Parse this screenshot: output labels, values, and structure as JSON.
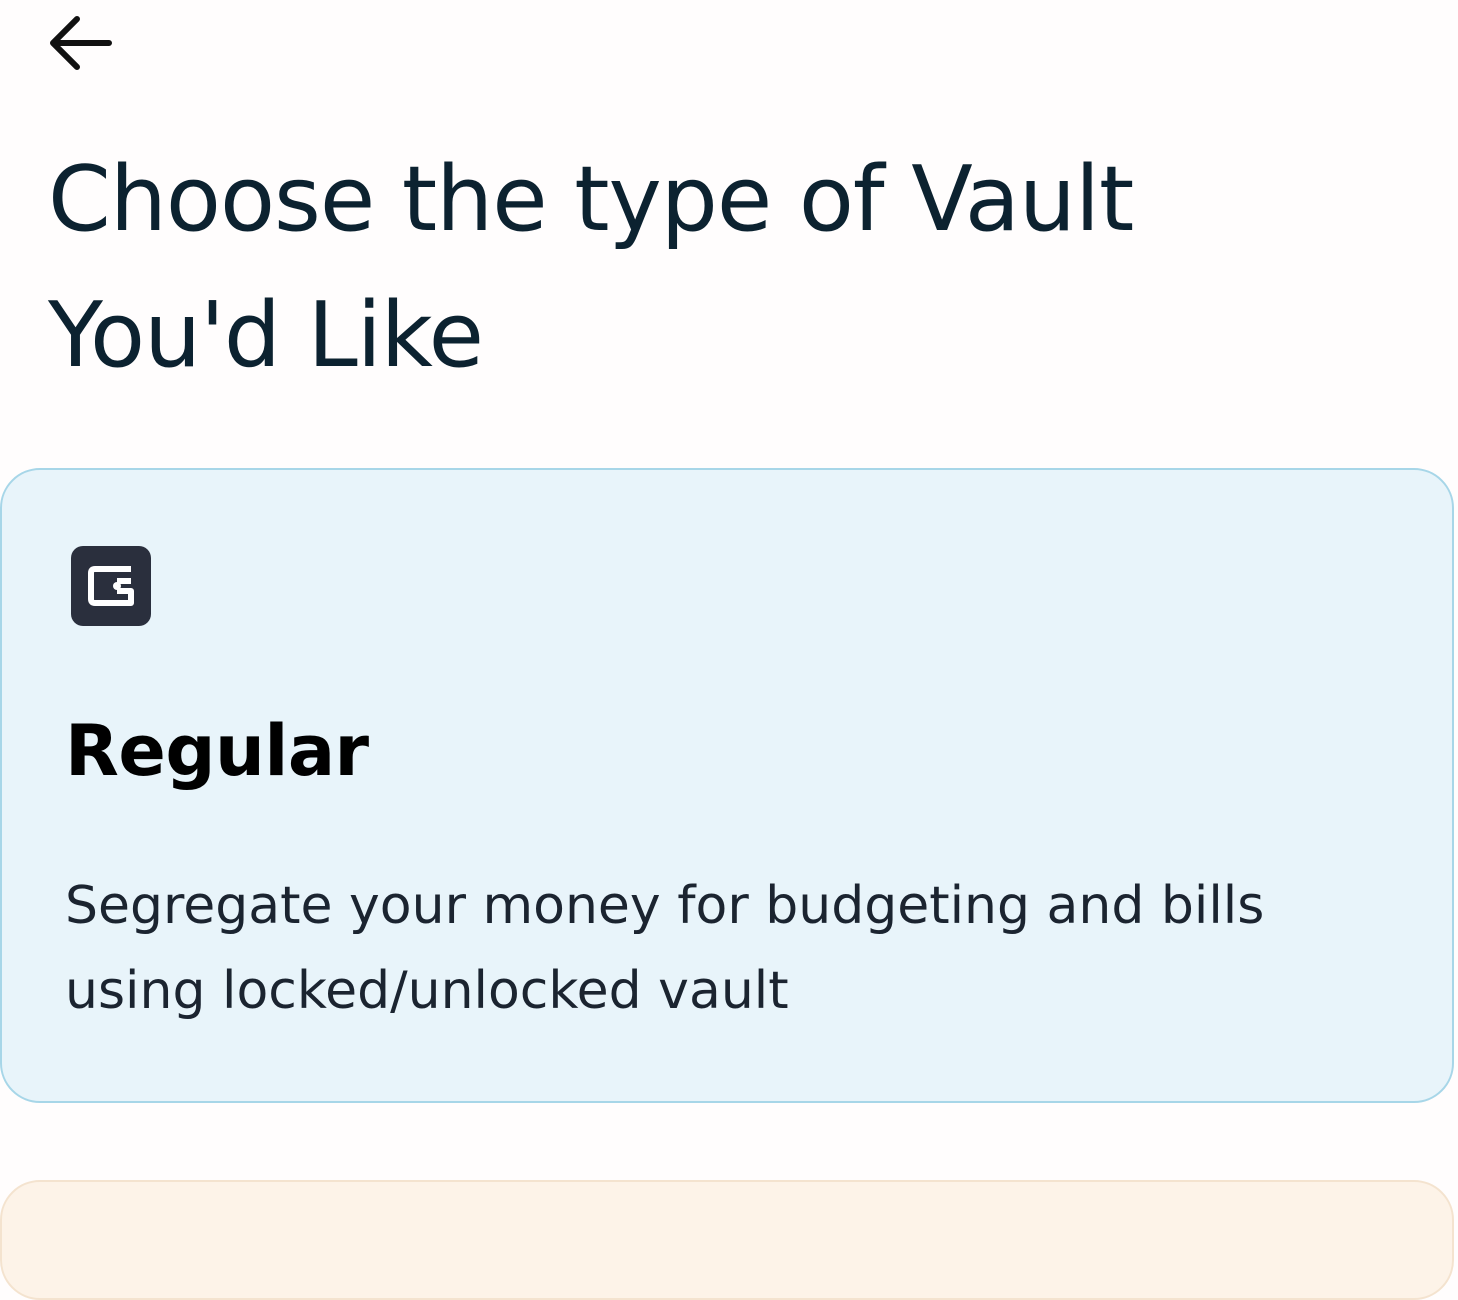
{
  "header": {
    "back_icon": "arrow-left-icon",
    "title": "Choose the type of Vault You'd Like"
  },
  "options": [
    {
      "icon": "vault-c-icon",
      "title": "Regular",
      "description": "Segregate your money for budgeting and bills using locked/unlocked vault",
      "background_color": "#e8f4fa",
      "border_color": "#a7d6e8"
    },
    {
      "background_color": "#fdf3e8"
    }
  ],
  "colors": {
    "title_text": "#0c2230",
    "icon_tile": "#2a2f3d"
  }
}
